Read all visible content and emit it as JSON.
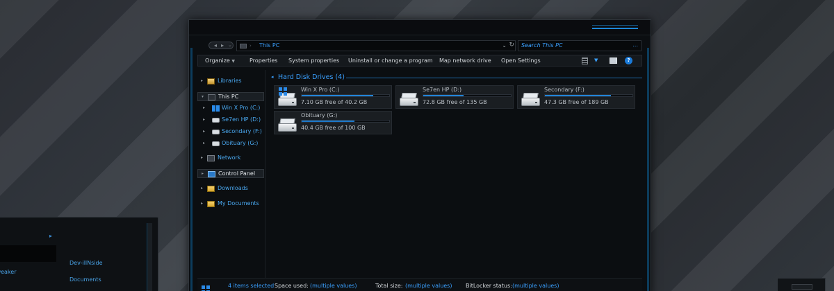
{
  "background_window": {
    "items": [
      "Tweaker",
      "Dev-illNside",
      "Documents"
    ]
  },
  "explorer": {
    "address": {
      "path": "This PC",
      "search_placeholder": "Search This PC",
      "search_more": "..."
    },
    "toolbar": {
      "buttons": [
        {
          "label": "Organize",
          "has_caret": true
        },
        {
          "label": "Properties"
        },
        {
          "label": "System properties"
        },
        {
          "label": "Uninstall or change a program"
        },
        {
          "label": "Map network drive"
        },
        {
          "label": "Open Settings"
        }
      ],
      "help_label": "?"
    },
    "nav": {
      "items": [
        {
          "label": "Libraries",
          "icon": "library-icon"
        },
        {
          "label": "This PC",
          "icon": "computer-icon",
          "selected": true
        },
        {
          "label": "Win X Pro (C:)",
          "icon": "drive-icon"
        },
        {
          "label": "Se7en HP (D:)",
          "icon": "drive-icon"
        },
        {
          "label": "Secondary (F:)",
          "icon": "drive-icon"
        },
        {
          "label": "Obituary (G:)",
          "icon": "drive-icon"
        },
        {
          "label": "Network",
          "icon": "network-icon"
        },
        {
          "label": "Control Panel",
          "icon": "control-panel-icon",
          "selected": true
        },
        {
          "label": "Downloads",
          "icon": "folder-icon"
        },
        {
          "label": "My Documents",
          "icon": "documents-icon"
        }
      ]
    },
    "content": {
      "group_title": "Hard Disk Drives (4)",
      "drives": [
        {
          "name": "Win X Pro (C:)",
          "free_text": "7.10 GB free of 40.2 GB",
          "used_fraction": 0.82,
          "system": true
        },
        {
          "name": "Se7en HP (D:)",
          "free_text": "72.8 GB free of 135 GB",
          "used_fraction": 0.46
        },
        {
          "name": "Secondary (F:)",
          "free_text": "47.3 GB free of 189 GB",
          "used_fraction": 0.75
        },
        {
          "name": "Obituary (G:)",
          "free_text": "40.4 GB free of 100 GB",
          "used_fraction": 0.6
        }
      ]
    },
    "status": {
      "items_selected": "4 items selected",
      "space_used_label": "Space used:",
      "space_used_value": "(multiple values)",
      "total_size_label": "Total size:",
      "total_size_value": "(multiple values)",
      "bitlocker_label": "BitLocker status:",
      "bitlocker_value": "(multiple values)"
    },
    "colors": {
      "accent": "#3aa0ff",
      "window_bg": "#0b0e11",
      "tile_bg": "#1a1e22"
    }
  }
}
